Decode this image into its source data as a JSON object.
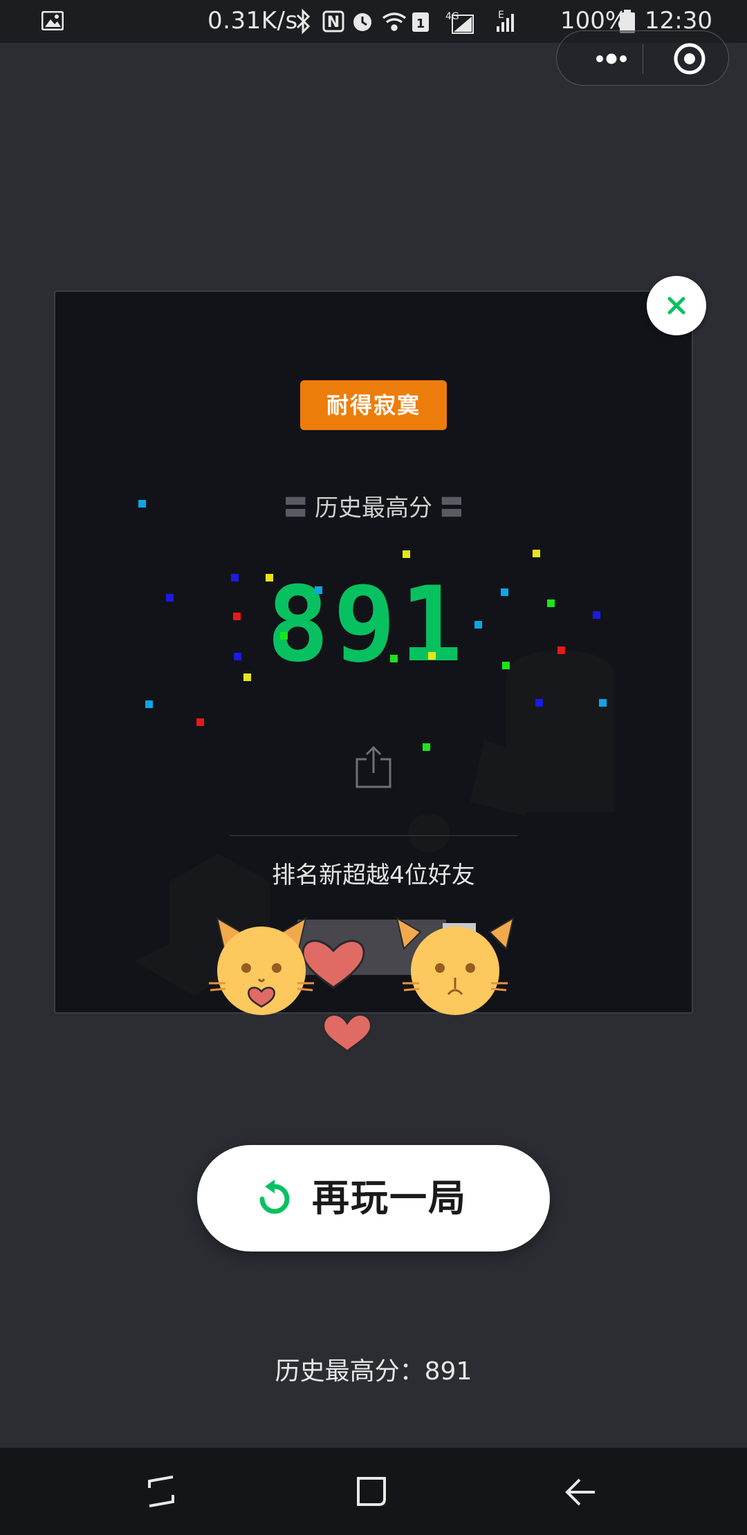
{
  "status_bar": {
    "speed": "0.31K/s",
    "battery": "100%",
    "time": "12:30",
    "icons": [
      "image-icon",
      "bluetooth-icon",
      "nfc-icon",
      "alarm-icon",
      "wifi-icon",
      "sim1-icon",
      "4g-signal-icon",
      "e-signal-icon",
      "battery-icon"
    ]
  },
  "capsule": {
    "icons": [
      "more-icon",
      "target-icon"
    ]
  },
  "card": {
    "badge": "耐得寂寞",
    "best_label": "历史最高分",
    "score": "891",
    "rank_text": "排名新超越4位好友"
  },
  "replay": {
    "label": "再玩一局"
  },
  "bottom": {
    "best_text": "历史最高分：891"
  },
  "colors": {
    "accent_green": "#07c160",
    "badge_orange": "#ed7d0b",
    "background": "#2b2d33",
    "card_bg": "#121318"
  }
}
